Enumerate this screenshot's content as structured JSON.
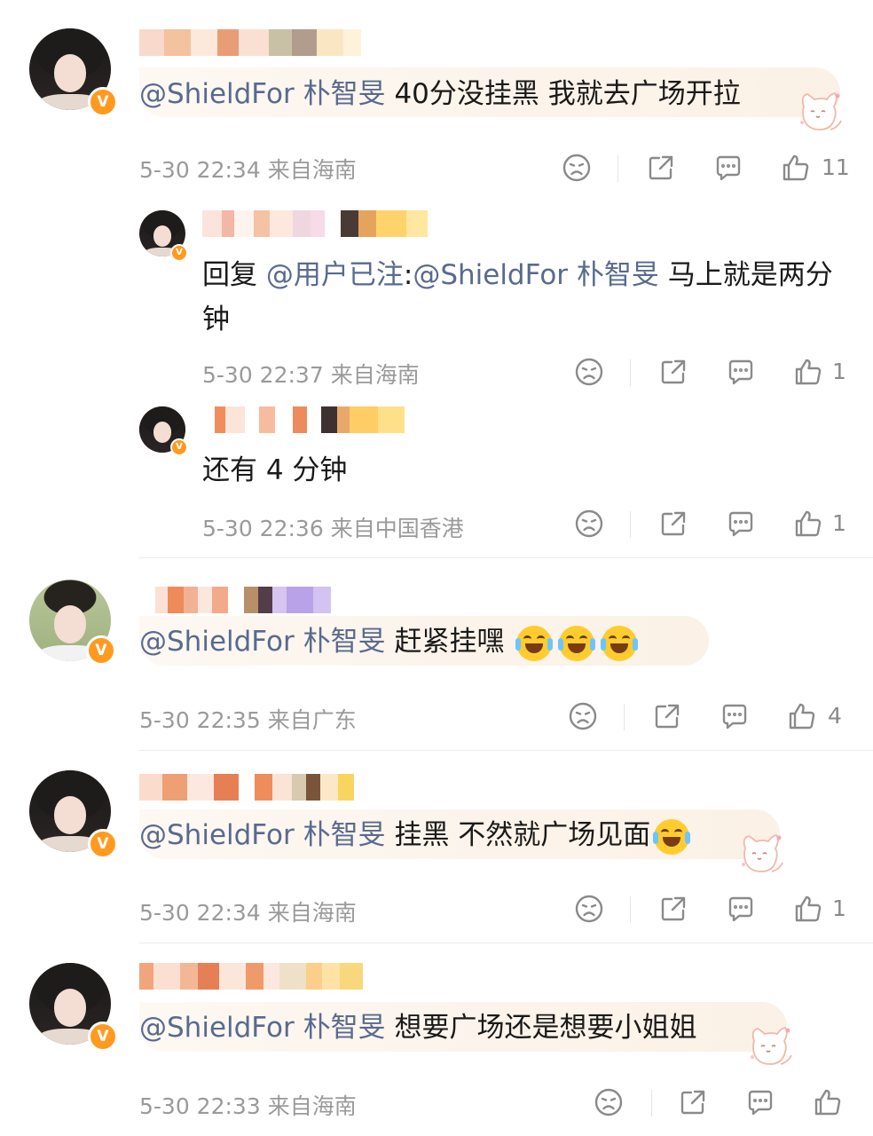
{
  "comments": [
    {
      "mention": "@ShieldFor 朴智旻",
      "body": " 40分没挂黑 我就去广场开拉",
      "time": "5-30 22:34",
      "location": "来自海南",
      "likes": "11"
    },
    {
      "reply_prefix": "回复 ",
      "reply_to": "@用户已注",
      "colon": ":",
      "mention": "@ShieldFor 朴智旻",
      "body": " 马上就是两分钟",
      "time": "5-30 22:37",
      "location": "来自海南",
      "likes": "1"
    },
    {
      "body": "还有 4 分钟",
      "time": "5-30 22:36",
      "location": "来自中国香港",
      "likes": "1"
    },
    {
      "mention": "@ShieldFor 朴智旻",
      "body": " 赶紧挂嘿",
      "time": "5-30 22:35",
      "location": "来自广东",
      "likes": "4"
    },
    {
      "mention": "@ShieldFor 朴智旻",
      "body": " 挂黑 不然就广场见面",
      "time": "5-30 22:34",
      "location": "来自海南",
      "likes": "1"
    },
    {
      "mention": "@ShieldFor 朴智旻",
      "body": " 想要广场还是想要小姐姐",
      "time": "5-30 22:33",
      "location": "来自海南"
    }
  ],
  "badge": "V",
  "icons": [
    "dislike-icon",
    "share-icon",
    "comment-icon",
    "like-icon",
    "verified-badge-icon",
    "laugh-cry-emoji"
  ],
  "colors": {
    "mention": "#596a8e",
    "badge": "#ff9a1f",
    "meta": "#9a9a9a"
  }
}
